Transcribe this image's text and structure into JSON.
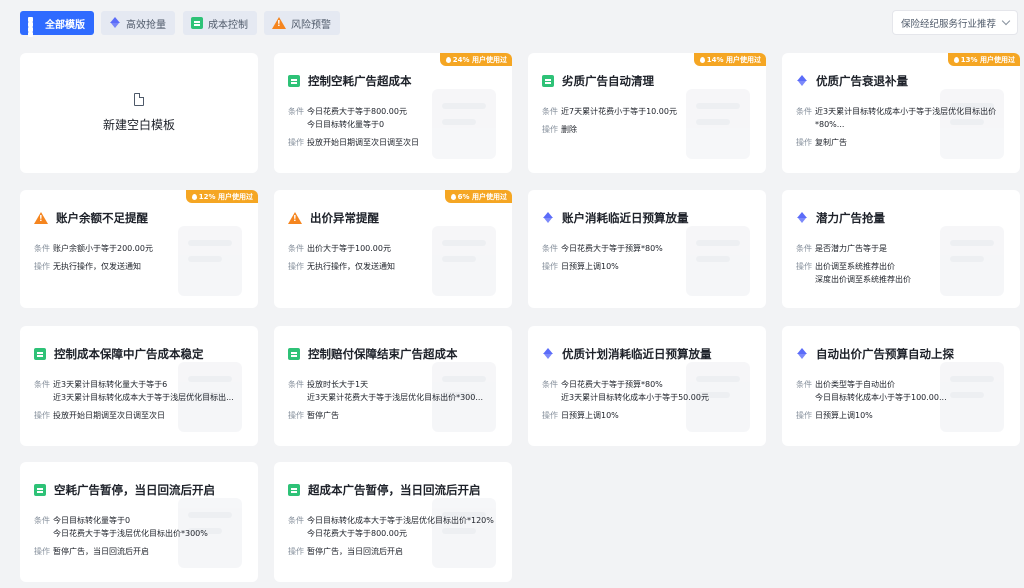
{
  "tabs": [
    {
      "label": "全部模版",
      "icon": "grid-icon"
    },
    {
      "label": "高效抢量",
      "icon": "arrow-up-icon"
    },
    {
      "label": "成本控制",
      "icon": "list-icon"
    },
    {
      "label": "风险预警",
      "icon": "warning-icon"
    }
  ],
  "dropdown": {
    "value": "保险经纪服务行业推荐"
  },
  "blank_card": {
    "label": "新建空白模板"
  },
  "labels": {
    "cond": "条件",
    "op": "操作"
  },
  "cards": [
    {
      "title": "控制空耗广告超成本",
      "icon": "list-icon",
      "badge": "24% 用户使用过",
      "cond": [
        "今日花费大于等于800.00元",
        "今日目标转化量等于0"
      ],
      "op": [
        "投放开始日期调至次日调至次日"
      ]
    },
    {
      "title": "劣质广告自动清理",
      "icon": "list-icon",
      "badge": "14% 用户使用过",
      "cond": [
        "近7天累计花费小于等于10.00元"
      ],
      "op": [
        "删除"
      ]
    },
    {
      "title": "优质广告衰退补量",
      "icon": "arrow-up-icon",
      "badge": "13% 用户使用过",
      "cond": [
        "近3天累计目标转化成本小于等于浅层优化目标出价",
        "*80%..."
      ],
      "op": [
        "复制广告"
      ]
    },
    {
      "title": "账户余额不足提醒",
      "icon": "warning-icon",
      "badge": "12% 用户使用过",
      "cond": [
        "账户余额小于等于200.00元"
      ],
      "op": [
        "无执行操作，仅发送通知"
      ]
    },
    {
      "title": "出价异常提醒",
      "icon": "warning-icon",
      "badge": "6% 用户使用过",
      "cond": [
        "出价大于等于100.00元"
      ],
      "op": [
        "无执行操作，仅发送通知"
      ]
    },
    {
      "title": "账户消耗临近日预算放量",
      "icon": "arrow-up-icon",
      "badge": "",
      "cond": [
        "今日花费大于等于预算*80%"
      ],
      "op": [
        "日预算上调10%"
      ]
    },
    {
      "title": "潜力广告抢量",
      "icon": "arrow-up-icon",
      "badge": "",
      "cond": [
        "是否潜力广告等于是"
      ],
      "op": [
        "出价调至系统推荐出价",
        "深度出价调至系统推荐出价"
      ]
    },
    {
      "title": "控制成本保障中广告成本稳定",
      "icon": "list-icon",
      "badge": "",
      "cond": [
        "近3天累计目标转化量大于等于6",
        "近3天累计目标转化成本大于等于浅层优化目标出..."
      ],
      "op": [
        "投放开始日期调至次日调至次日"
      ]
    },
    {
      "title": "控制赔付保障结束广告超成本",
      "icon": "list-icon",
      "badge": "",
      "cond": [
        "投放时长大于1天",
        "近3天累计花费大于等于浅层优化目标出价*300..."
      ],
      "op": [
        "暂停广告"
      ]
    },
    {
      "title": "优质计划消耗临近日预算放量",
      "icon": "arrow-up-icon",
      "badge": "",
      "cond": [
        "今日花费大于等于预算*80%",
        "近3天累计目标转化成本小于等于50.00元"
      ],
      "op": [
        "日预算上调10%"
      ]
    },
    {
      "title": "自动出价广告预算自动上探",
      "icon": "arrow-up-icon",
      "badge": "",
      "cond": [
        "出价类型等于自动出价",
        "今日目标转化成本小于等于100.00..."
      ],
      "op": [
        "日预算上调10%"
      ]
    },
    {
      "title": "空耗广告暂停，当日回流后开启",
      "icon": "list-icon",
      "badge": "",
      "cond": [
        "今日目标转化量等于0",
        "今日花费大于等于浅层优化目标出价*300%"
      ],
      "op": [
        "暂停广告，当日回流后开启"
      ]
    },
    {
      "title": "超成本广告暂停，当日回流后开启",
      "icon": "list-icon",
      "badge": "",
      "cond": [
        "今日目标转化成本大于等于浅层优化目标出价*120%",
        "今日花费大于等于800.00元"
      ],
      "op": [
        "暂停广告，当日回流后开启"
      ]
    }
  ]
}
